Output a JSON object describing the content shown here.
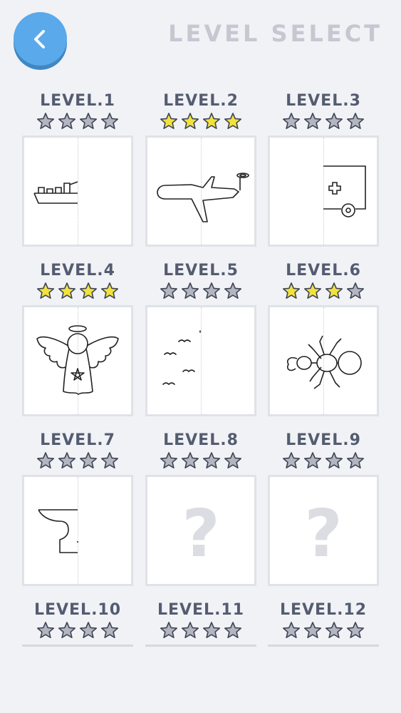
{
  "header": {
    "title": "LEVEL SELECT",
    "back_icon": "chevron-left-icon"
  },
  "colors": {
    "star_filled": "#f2e23e",
    "star_empty": "#b3b6be",
    "accent": "#5aa9ea"
  },
  "levels": [
    {
      "label": "LEVEL.1",
      "stars": 0,
      "max_stars": 4,
      "thumbnail": "cargo-ship"
    },
    {
      "label": "LEVEL.2",
      "stars": 4,
      "max_stars": 4,
      "thumbnail": "airplane"
    },
    {
      "label": "LEVEL.3",
      "stars": 0,
      "max_stars": 4,
      "thumbnail": "ambulance"
    },
    {
      "label": "LEVEL.4",
      "stars": 4,
      "max_stars": 4,
      "thumbnail": "angel"
    },
    {
      "label": "LEVEL.5",
      "stars": 0,
      "max_stars": 4,
      "thumbnail": "birds"
    },
    {
      "label": "LEVEL.6",
      "stars": 3,
      "max_stars": 4,
      "thumbnail": "ant"
    },
    {
      "label": "LEVEL.7",
      "stars": 0,
      "max_stars": 4,
      "thumbnail": "anvil"
    },
    {
      "label": "LEVEL.8",
      "stars": 0,
      "max_stars": 4,
      "thumbnail": "locked",
      "locked_text": "?"
    },
    {
      "label": "LEVEL.9",
      "stars": 0,
      "max_stars": 4,
      "thumbnail": "locked",
      "locked_text": "?"
    },
    {
      "label": "LEVEL.10",
      "stars": 0,
      "max_stars": 4,
      "thumbnail": "hidden"
    },
    {
      "label": "LEVEL.11",
      "stars": 0,
      "max_stars": 4,
      "thumbnail": "hidden"
    },
    {
      "label": "LEVEL.12",
      "stars": 0,
      "max_stars": 4,
      "thumbnail": "hidden"
    }
  ]
}
